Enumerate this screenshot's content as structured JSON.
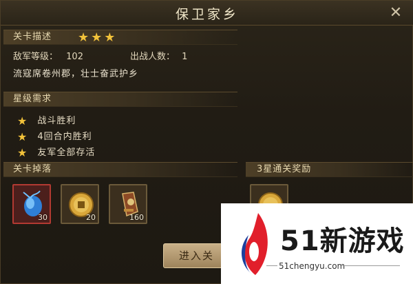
{
  "window": {
    "title": "保卫家乡"
  },
  "stage_info": {
    "header": "关卡描述",
    "stars": 3,
    "enemy_level_label": "敌军等级：",
    "enemy_level_value": "102",
    "deploy_count_label": "出战人数：",
    "deploy_count_value": "1",
    "description": "流寇席卷州郡，壮士奋武护乡"
  },
  "star_requirements": {
    "header": "星级需求",
    "items": [
      "战斗胜利",
      "4回合内胜利",
      "友军全部存活"
    ]
  },
  "drops": {
    "header": "关卡掉落",
    "items": [
      {
        "icon": "blue-gem-icon",
        "qty": "30"
      },
      {
        "icon": "gold-coin-icon",
        "qty": "20"
      },
      {
        "icon": "gourd-bag-icon",
        "qty": "160"
      }
    ]
  },
  "reward": {
    "header": "3星通关奖励",
    "icon": "gold-coin-icon"
  },
  "enter_button": {
    "label": "进入关"
  },
  "watermark": {
    "logo_text": "51新游戏",
    "url": "51chengyu.com"
  },
  "colors": {
    "star": "#f2c23a",
    "accent": "#e2cd9f",
    "selected_border": "#b33a32"
  }
}
